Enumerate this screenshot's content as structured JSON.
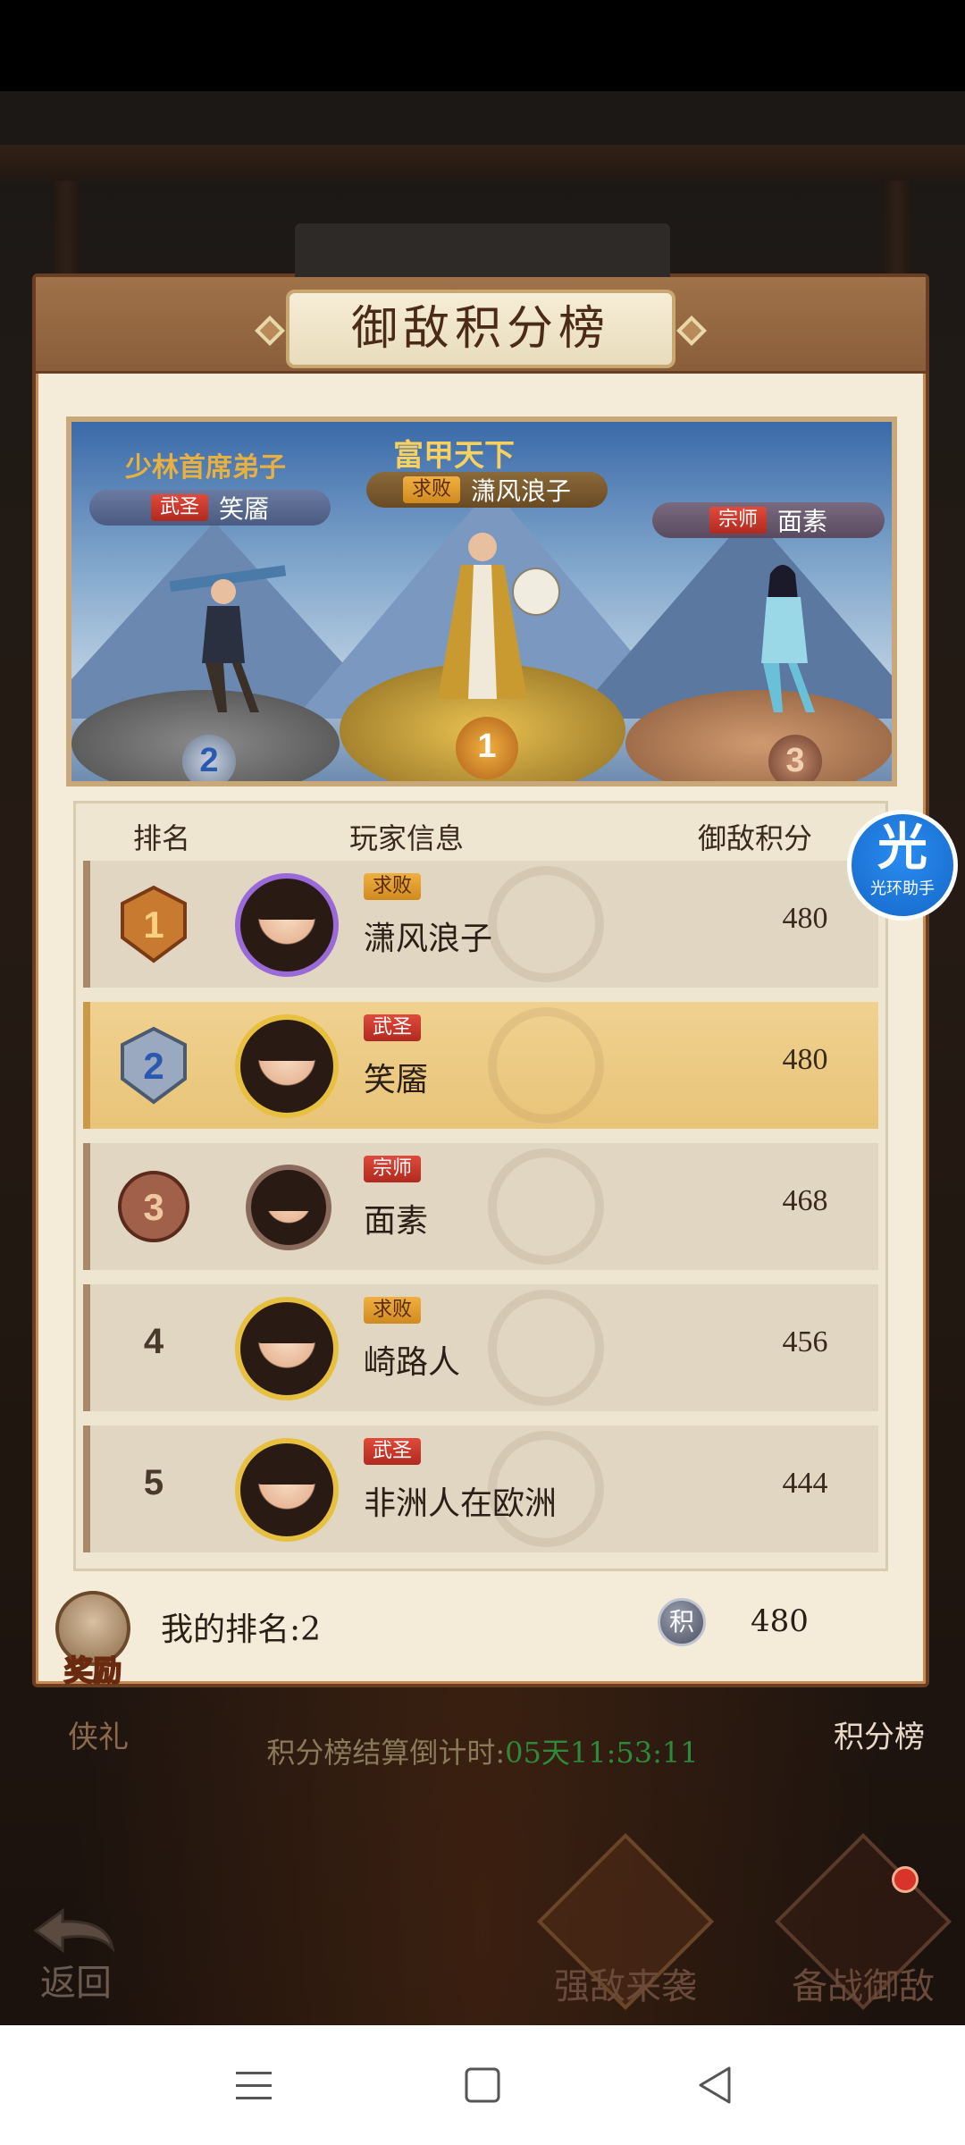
{
  "panel": {
    "title": "御敌积分榜"
  },
  "podium": {
    "top": [
      {
        "rank": "2",
        "title_art": "少林首席弟子",
        "badge": "武圣",
        "name": "笑靥"
      },
      {
        "rank": "1",
        "title_art": "富甲天下",
        "badge": "求败",
        "name": "潇风浪子"
      },
      {
        "rank": "3",
        "title_art": "",
        "badge": "宗师",
        "name": "面素"
      }
    ]
  },
  "table": {
    "headers": {
      "rank": "排名",
      "player": "玩家信息",
      "score": "御敌积分"
    },
    "rows": [
      {
        "rank": "1",
        "badge": "求败",
        "name": "潇风浪子",
        "score": "480"
      },
      {
        "rank": "2",
        "badge": "武圣",
        "name": "笑靥",
        "score": "480"
      },
      {
        "rank": "3",
        "badge": "宗师",
        "name": "面素",
        "score": "468"
      },
      {
        "rank": "4",
        "badge": "求败",
        "name": "崎路人",
        "score": "456"
      },
      {
        "rank": "5",
        "badge": "武圣",
        "name": "非洲人在欧洲",
        "score": "444"
      }
    ]
  },
  "footer": {
    "reward_label": "奖励",
    "my_rank": "我的排名:2",
    "score_icon": "积",
    "my_score": "480"
  },
  "background": {
    "left_button": "侠礼",
    "right_button": "积分榜",
    "countdown_label": "积分榜结算倒计时:",
    "countdown_time": "05天11:53:11",
    "back_label": "返回",
    "btn_enemy": "强敌来袭",
    "btn_prepare": "备战御敌"
  },
  "assistant": {
    "glyph": "光",
    "label": "光环助手"
  },
  "icons": {
    "nav_menu": "menu-icon",
    "nav_home": "home-square-icon",
    "nav_back": "back-triangle-icon"
  }
}
